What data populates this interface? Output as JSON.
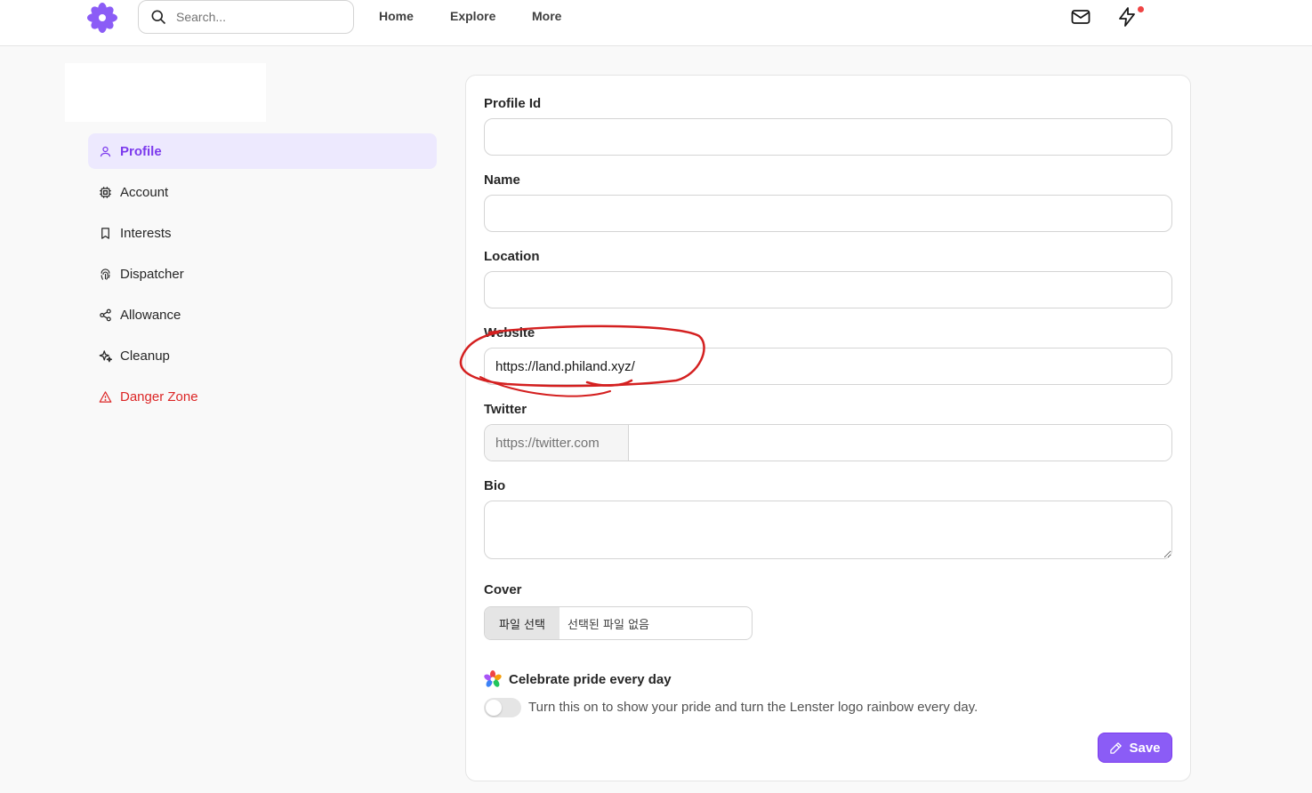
{
  "header": {
    "search": {
      "placeholder": "Search...",
      "value": ""
    },
    "nav": [
      {
        "label": "Home"
      },
      {
        "label": "Explore"
      },
      {
        "label": "More"
      }
    ],
    "icons": [
      "logo-icon",
      "search-icon",
      "mail-icon",
      "lightning-icon"
    ]
  },
  "sidebar": {
    "items": [
      {
        "label": "Profile",
        "icon": "user-icon",
        "active": true
      },
      {
        "label": "Account",
        "icon": "cpu-icon"
      },
      {
        "label": "Interests",
        "icon": "bookmark-icon"
      },
      {
        "label": "Dispatcher",
        "icon": "fingerprint-icon"
      },
      {
        "label": "Allowance",
        "icon": "share-icon"
      },
      {
        "label": "Cleanup",
        "icon": "sparkles-icon"
      },
      {
        "label": "Danger Zone",
        "icon": "warning-icon",
        "danger": true
      }
    ]
  },
  "form": {
    "profile_id": {
      "label": "Profile Id",
      "value": ""
    },
    "name": {
      "label": "Name",
      "value": ""
    },
    "location": {
      "label": "Location",
      "value": ""
    },
    "website": {
      "label": "Website",
      "value": "https://land.philand.xyz/"
    },
    "twitter": {
      "label": "Twitter",
      "prefix": "https://twitter.com",
      "value": ""
    },
    "bio": {
      "label": "Bio",
      "value": ""
    },
    "cover": {
      "label": "Cover",
      "button": "파일 선택",
      "status": "선택된 파일 없음"
    },
    "pride": {
      "title": "Celebrate pride every day",
      "description": "Turn this on to show your pride and turn the Lenster logo rainbow every day.",
      "enabled": false
    },
    "save_label": "Save"
  },
  "colors": {
    "accent": "#8b5cf6",
    "accent_bg": "#ede9fe",
    "danger": "#dc2626",
    "annotation": "#d42020"
  }
}
